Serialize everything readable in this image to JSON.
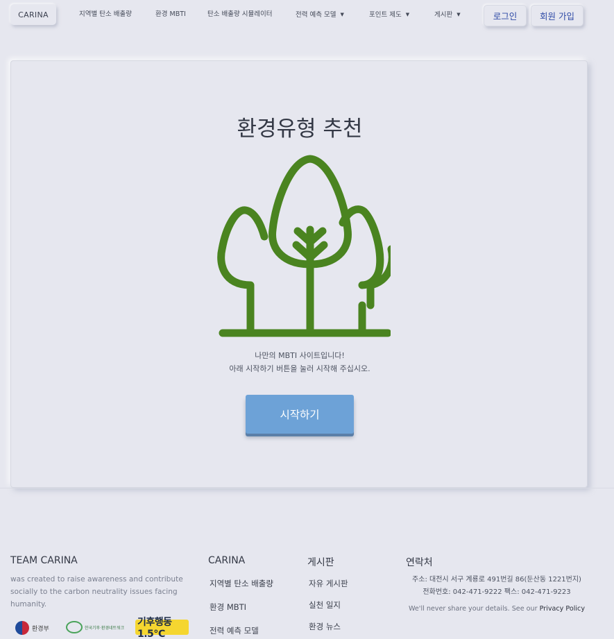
{
  "nav": {
    "brand": "CARINA",
    "items": [
      {
        "label": "지역별 탄소 배출량",
        "dropdown": false
      },
      {
        "label": "환경 MBTI",
        "dropdown": false
      },
      {
        "label": "탄소 배출량 시뮬레이터",
        "dropdown": false
      },
      {
        "label": "전력 예측 모델",
        "dropdown": true
      },
      {
        "label": "포인트 제도",
        "dropdown": true
      },
      {
        "label": "게시판",
        "dropdown": true
      }
    ],
    "login_label": "로그인",
    "signup_label": "회원 가입"
  },
  "main": {
    "title": "환경유형 추천",
    "illustration_icon": "trees-icon",
    "description_line1": "나만의 MBTI 사이트입니다!",
    "description_line2": "아래 시작하기 버튼을 눌러 시작해 주십시오.",
    "start_label": "시작하기"
  },
  "footer": {
    "team": {
      "title": "TEAM CARINA",
      "description": "was created to raise awareness and contribute socially to the carbon neutrality issues facing humanity.",
      "logos": [
        {
          "icon": "ministry-of-environment-logo",
          "text": "환경부"
        },
        {
          "icon": "climate-network-logo",
          "text": "한국기후·환경네트워크"
        },
        {
          "icon": "climate-action-logo",
          "text": "기후행동 1.5℃"
        }
      ]
    },
    "carina": {
      "title": "CARINA",
      "links": [
        "지역별 탄소 배출량",
        "환경 MBTI",
        "전력 예측 모델"
      ]
    },
    "board": {
      "title": "게시판",
      "links": [
        "자유 게시판",
        "실천 일지",
        "환경 뉴스"
      ]
    },
    "contact": {
      "title": "연락처",
      "address": "주소: 대전시 서구 계룡로 491번길 86(둔산동 1221번지)",
      "phone": "전화번호: 042-471-9222 팩스: 042-471-9223",
      "privacy_prefix": "We'll never share your details. See our",
      "privacy_link": "Privacy Policy"
    }
  },
  "colors": {
    "background": "#e6e7ef",
    "tree_green": "#4a8420",
    "button_blue": "#6da2d7",
    "link_blue": "#2e4aa6"
  }
}
